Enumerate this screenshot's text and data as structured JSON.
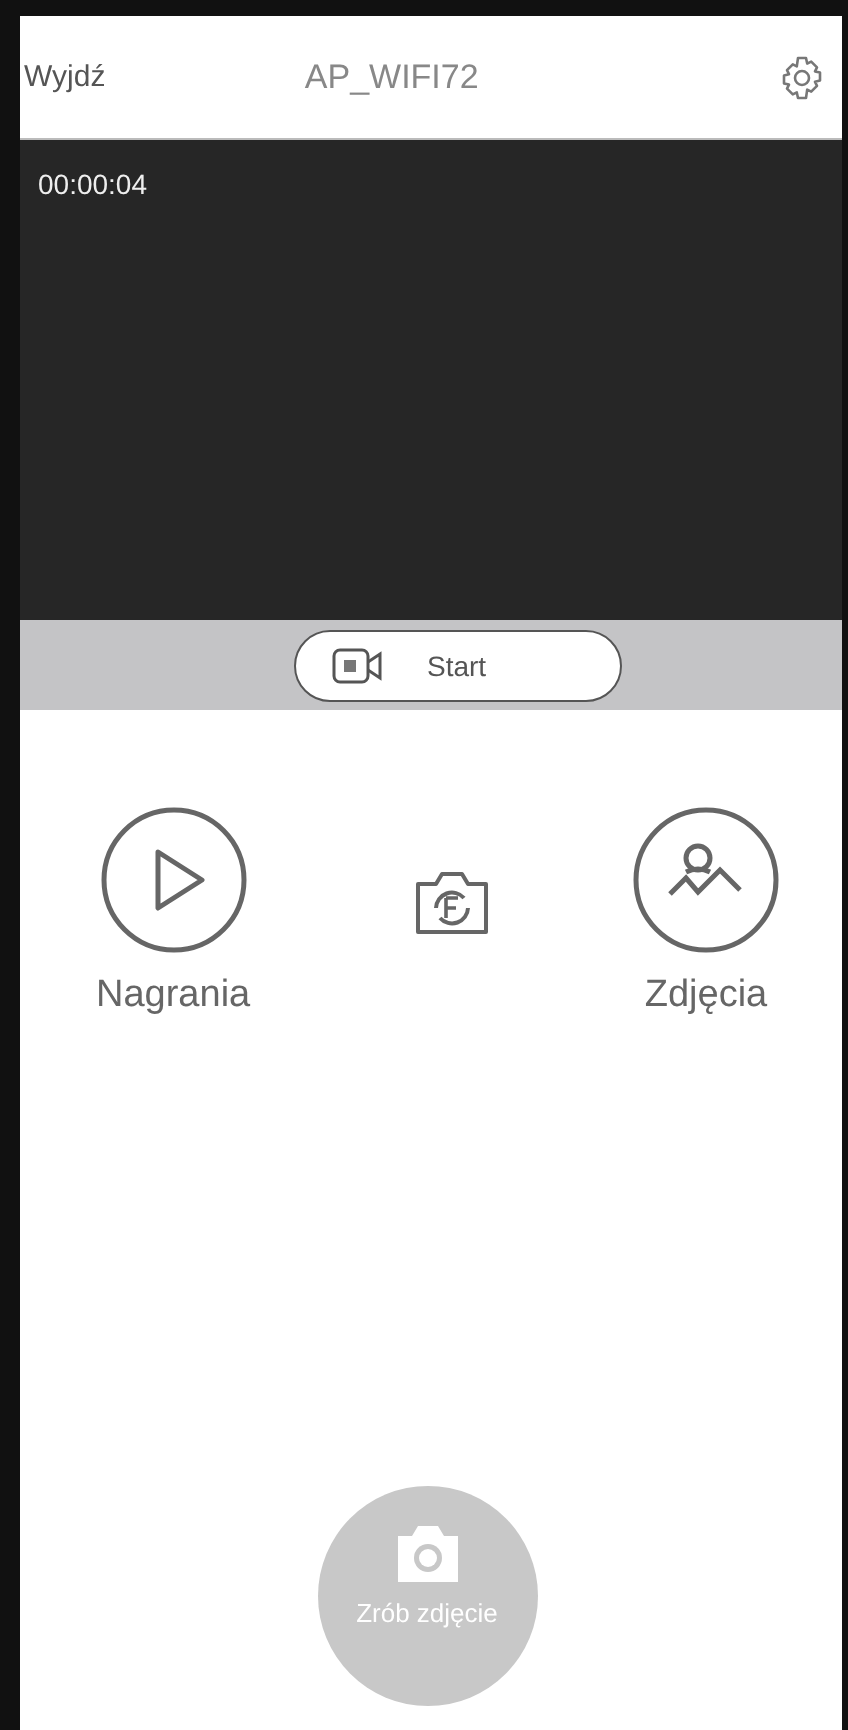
{
  "header": {
    "exit": "Wyjdź",
    "title": "AP_WIFI72"
  },
  "video": {
    "timestamp": "00:00:04"
  },
  "record_button": {
    "label": "Start"
  },
  "actions": [
    {
      "kind": "recordings",
      "label": "Nagrania"
    },
    {
      "kind": "switch"
    },
    {
      "kind": "photos",
      "label": "Zdjęcia"
    }
  ],
  "capture_button": {
    "label": "Zrób zdjęcie"
  }
}
